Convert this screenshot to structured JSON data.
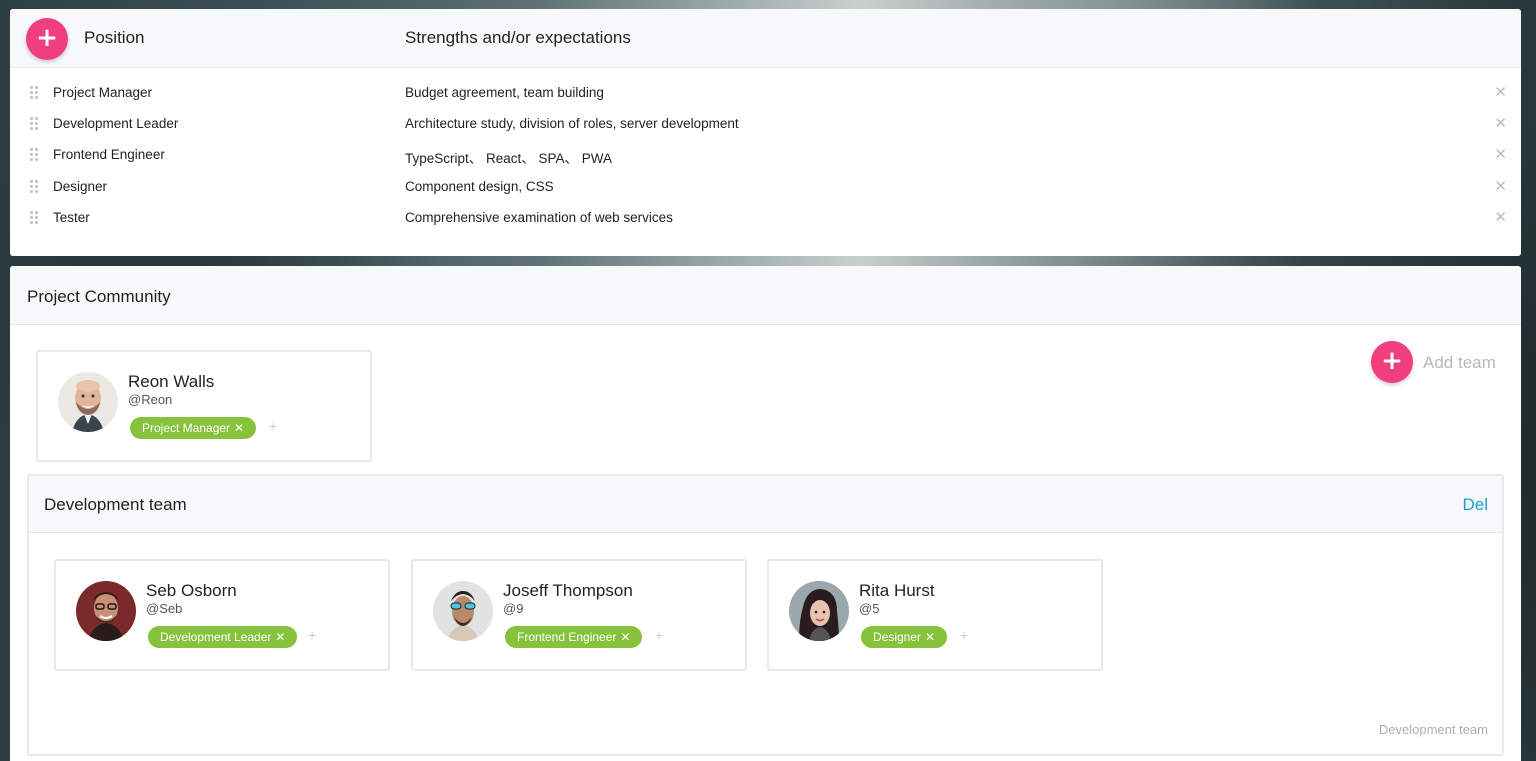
{
  "positions": {
    "header": {
      "position_label": "Position",
      "strengths_label": "Strengths and/or expectations",
      "add_icon": "plus-icon"
    },
    "rows": [
      {
        "name": "Project Manager",
        "desc": "Budget agreement, team building"
      },
      {
        "name": "Development Leader",
        "desc": "Architecture study, division of roles, server development"
      },
      {
        "name": "Frontend Engineer",
        "desc": "TypeScript、 React、 SPA、 PWA"
      },
      {
        "name": "Designer",
        "desc": "Component design, CSS"
      },
      {
        "name": "Tester",
        "desc": "Comprehensive examination of web services"
      }
    ],
    "remove_glyph": "✕"
  },
  "community": {
    "title": "Project Community",
    "leader": {
      "name": "Reon Walls",
      "handle": "@Reon",
      "role": "Project Manager"
    },
    "add_team_label": "Add team",
    "team": {
      "title": "Development team",
      "del_label": "Del",
      "footer": "Development team",
      "members": [
        {
          "name": "Seb Osborn",
          "handle": "@Seb",
          "role": "Development Leader"
        },
        {
          "name": "Joseff Thompson",
          "handle": "@9",
          "role": "Frontend Engineer"
        },
        {
          "name": "Rita Hurst",
          "handle": "@5",
          "role": "Designer"
        }
      ]
    },
    "tag_remove_glyph": "✕",
    "tag_add_glyph": "+"
  },
  "colors": {
    "accent_pink": "#f03f7c",
    "tag_green": "#86c23b",
    "link_blue": "#1ba1d6"
  }
}
